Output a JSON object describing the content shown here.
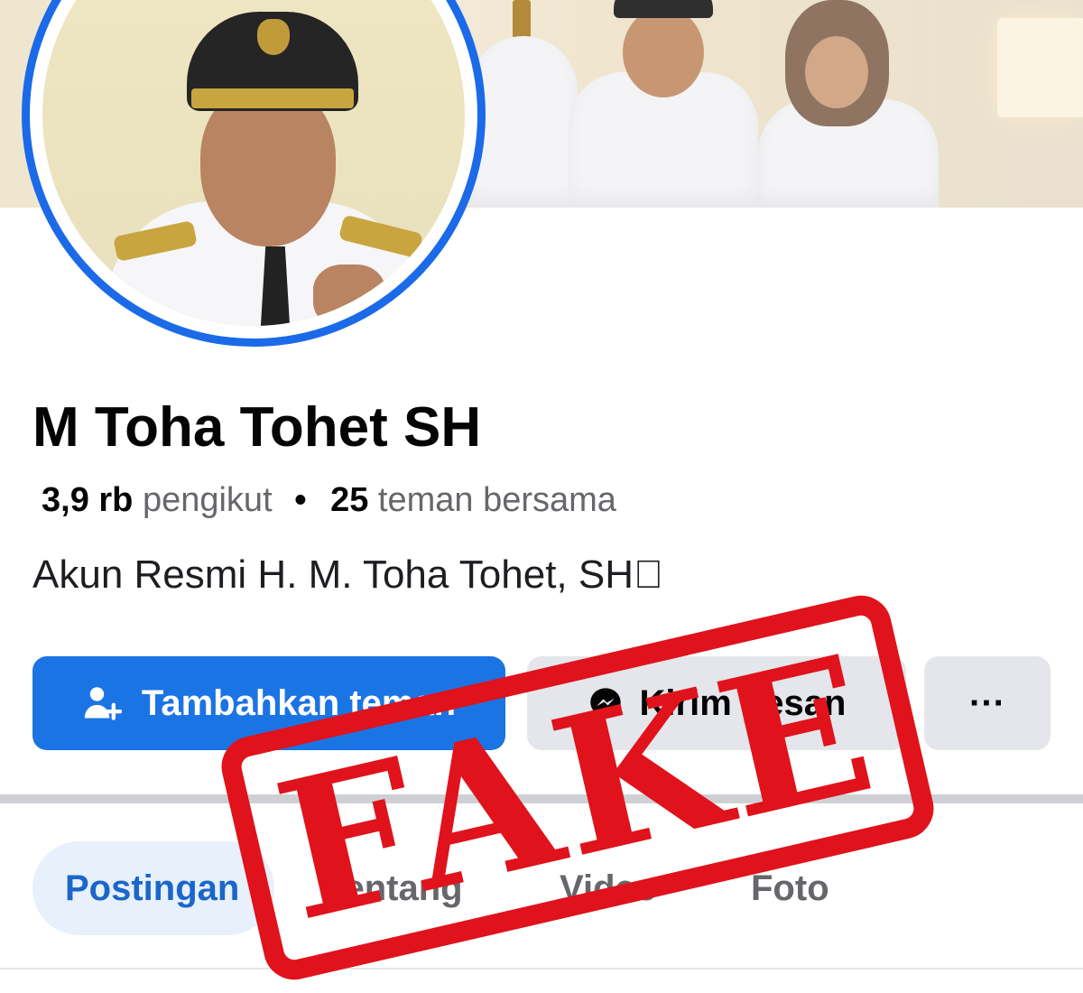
{
  "profile": {
    "name": "M Toha Tohet SH",
    "followers_count": "3,9 rb",
    "followers_label": "pengikut",
    "separator": "•",
    "mutual_count": "25",
    "mutual_label": "teman bersama",
    "bio": "Akun Resmi H. M. Toha Tohet, SH\u0000"
  },
  "actions": {
    "add_friend": "Tambahkan teman",
    "message": "Kirim pesan",
    "more": "···",
    "add_friend_icon": "add-person-icon",
    "message_icon": "messenger-icon"
  },
  "tabs": [
    {
      "label": "Postingan",
      "active": true
    },
    {
      "label": "Tentang",
      "active": false
    },
    {
      "label": "Video",
      "active": false
    },
    {
      "label": "Foto",
      "active": false
    }
  ],
  "stamp": {
    "text": "FAKE",
    "color": "#e0121b"
  },
  "colors": {
    "accent": "#1b74e4",
    "avatar_ring": "#1b6ae8",
    "tab_active_bg": "#e7f0fb"
  }
}
